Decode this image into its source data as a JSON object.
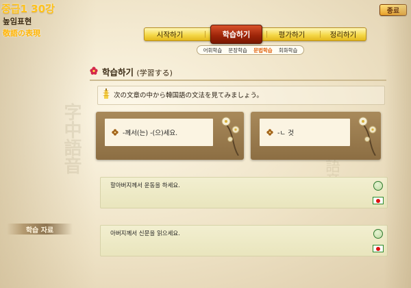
{
  "lesson": {
    "title": "중급1 30강",
    "subtitle_ko": "높임표현",
    "subtitle_jp": "敬語の表現"
  },
  "end_button": {
    "label": "종료"
  },
  "main_tabs": [
    {
      "label": "시작하기",
      "active": false
    },
    {
      "label": "학습하기",
      "active": true
    },
    {
      "label": "평가하기",
      "active": false
    },
    {
      "label": "정리하기",
      "active": false
    }
  ],
  "sub_tabs": [
    {
      "label": "어휘학습",
      "active": false
    },
    {
      "label": "문장학습",
      "active": false
    },
    {
      "label": "문법학습",
      "active": true
    },
    {
      "label": "회화학습",
      "active": false
    }
  ],
  "section": {
    "title": "학습하기",
    "title_jp": "(学習する)",
    "instruction": "次の文章の中から韓国語の文法を見てみましょう。"
  },
  "grammar_cards": [
    {
      "label": "-께서(는) -(으)세요."
    },
    {
      "label": "-ㄴ 것"
    }
  ],
  "examples": [
    {
      "text": "할아버지께서 운동을 하세요."
    },
    {
      "text": "아버지께서 신문을 읽으세요."
    }
  ],
  "side_panel": {
    "label": "학습 자료"
  },
  "icons": {
    "section": "flower-icon",
    "instruction": "pagoda-icon",
    "card": "flower-icon",
    "listen": "listen-icon",
    "translate": "japan-flag-icon"
  },
  "colors": {
    "accent": "#ffc21a",
    "active_tab": "#9b2308",
    "active_subtab": "#e05a00",
    "example_bg": "#efecc8"
  }
}
